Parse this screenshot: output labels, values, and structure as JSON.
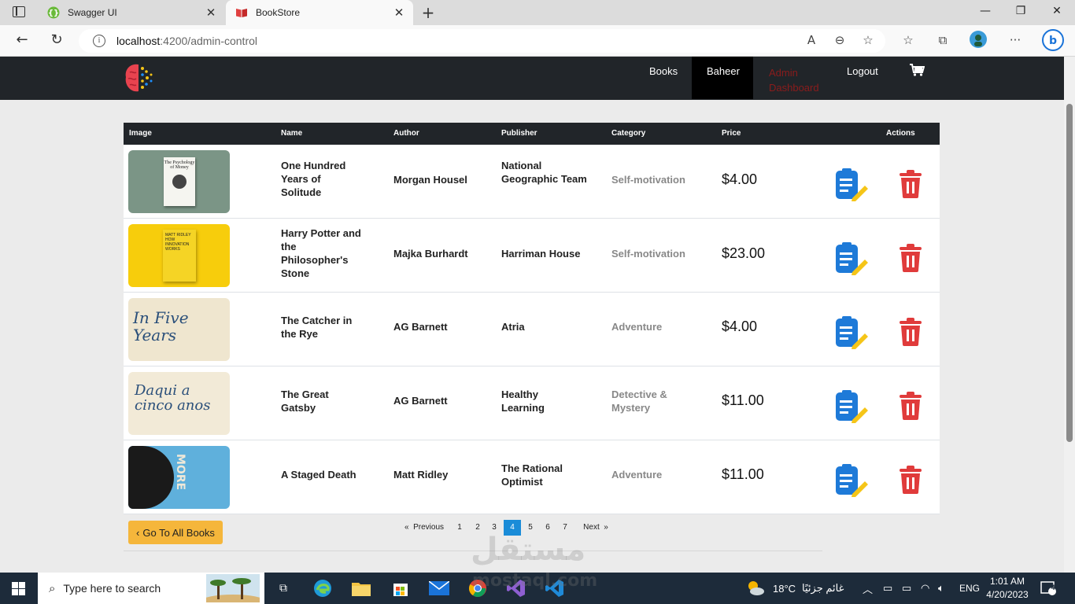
{
  "browser": {
    "tabs": [
      {
        "title": "Swagger UI",
        "active": false
      },
      {
        "title": "BookStore",
        "active": true
      }
    ],
    "url_host": "localhost",
    "url_path": ":4200/admin-control"
  },
  "nav": {
    "books": "Books",
    "user": "Baheer",
    "admin_line1": "Admin",
    "admin_line2": "Dashboard",
    "logout": "Logout"
  },
  "table": {
    "headers": {
      "image": "Image",
      "name": "Name",
      "author": "Author",
      "publisher": "Publisher",
      "category": "Category",
      "price": "Price",
      "actions": "Actions"
    },
    "rows": [
      {
        "name": "One Hundred Years of Solitude",
        "author": "Morgan Housel",
        "publisher": "National Geographic Team",
        "category": "Self-motivation",
        "price": "$4.00",
        "cover_title": "The Psychology of Money"
      },
      {
        "name": "Harry Potter and the Philosopher's Stone",
        "author": "Majka Burhardt",
        "publisher": "Harriman House",
        "category": "Self-motivation",
        "price": "$23.00",
        "cover_title": "MATT RIDLEY HOW INNOVATION WORKS"
      },
      {
        "name": "The Catcher in the Rye",
        "author": "AG Barnett",
        "publisher": "Atria",
        "category": "Adventure",
        "price": "$4.00",
        "cover_title": "In Five Years"
      },
      {
        "name": "The Great Gatsby",
        "author": "AG Barnett",
        "publisher": "Healthy Learning",
        "category": "Detective & Mystery",
        "price": "$11.00",
        "cover_title": "Daqui a cinco anos"
      },
      {
        "name": "A Staged Death",
        "author": "Matt Ridley",
        "publisher": "The Rational Optimist",
        "category": "Adventure",
        "price": "$11.00",
        "cover_title": "MORE"
      }
    ]
  },
  "back_button": "Go To All Books",
  "pagination": {
    "previous": "Previous",
    "next": "Next",
    "pages": [
      "1",
      "2",
      "3",
      "4",
      "5",
      "6",
      "7"
    ],
    "current": "4"
  },
  "watermark": {
    "arabic": "مستقل",
    "latin": "mostaql.com"
  },
  "taskbar": {
    "search_placeholder": "Type here to search",
    "weather": "18°C",
    "weather_desc": "غائم جزئيًا",
    "language": "ENG",
    "time": "1:01 AM",
    "date": "4/20/2023",
    "notifications": "4"
  },
  "colors": {
    "navbar": "#212529",
    "accent_button": "#f5b63b",
    "pager_current": "#1a8cd8",
    "delete_icon": "#e03b3b",
    "edit_icon": "#1e7ad8"
  }
}
